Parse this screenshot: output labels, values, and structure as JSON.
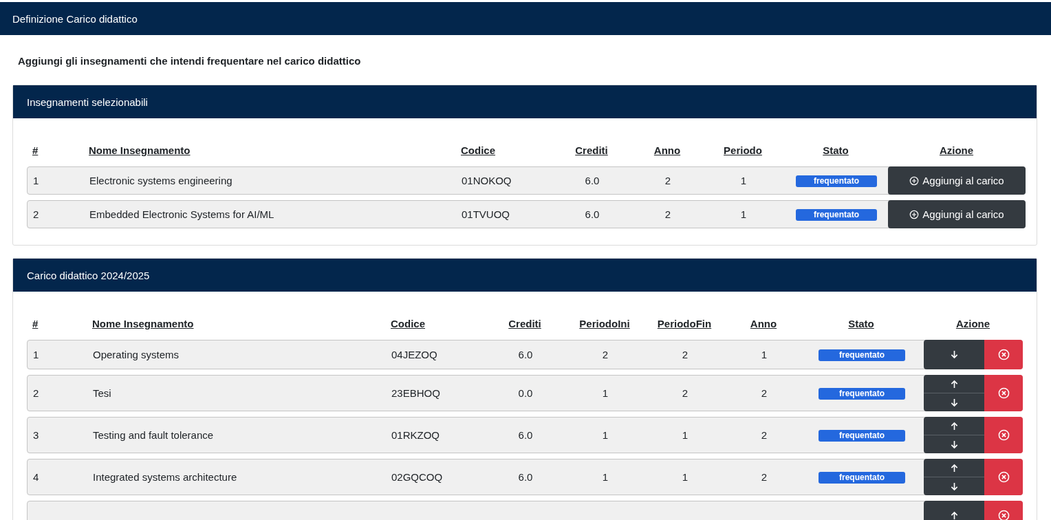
{
  "topbar": {
    "title": "Definizione Carico didattico"
  },
  "intro": "Aggiungi gli insegnamenti che intendi frequentare nel carico didattico",
  "selectable": {
    "title": "Insegnamenti selezionabili",
    "columns": [
      "#",
      "Nome Insegnamento",
      "Codice",
      "Crediti",
      "Anno",
      "Periodo",
      "Stato",
      "Azione"
    ],
    "rows": [
      {
        "n": "1",
        "name": "Electronic systems engineering",
        "code": "01NOKOQ",
        "credits": "6.0",
        "year": "2",
        "period": "1",
        "status": "frequentato",
        "action": "Aggiungi al carico"
      },
      {
        "n": "2",
        "name": "Embedded Electronic Systems for AI/ML",
        "code": "01TVUOQ",
        "credits": "6.0",
        "year": "2",
        "period": "1",
        "status": "frequentato",
        "action": "Aggiungi al carico"
      }
    ]
  },
  "load": {
    "title": "Carico didattico 2024/2025",
    "columns": [
      "#",
      "Nome Insegnamento",
      "Codice",
      "Crediti",
      "PeriodoIni",
      "PeriodoFin",
      "Anno",
      "Stato",
      "Azione"
    ],
    "rows": [
      {
        "kind": "full",
        "n": "1",
        "name": "Operating systems",
        "code": "04JEZOQ",
        "credits": "6.0",
        "period_start": "2",
        "period_end": "2",
        "year": "1",
        "status": "frequentato",
        "can_move_up": false,
        "can_move_down": true
      },
      {
        "kind": "full",
        "n": "2",
        "name": "Tesi",
        "code": "23EBHOQ",
        "credits": "0.0",
        "period_start": "1",
        "period_end": "2",
        "year": "2",
        "status": "frequentato",
        "can_move_up": true,
        "can_move_down": true
      },
      {
        "kind": "full",
        "n": "3",
        "name": "Testing and fault tolerance",
        "code": "01RKZOQ",
        "credits": "6.0",
        "period_start": "1",
        "period_end": "1",
        "year": "2",
        "status": "frequentato",
        "can_move_up": true,
        "can_move_down": true
      },
      {
        "kind": "full",
        "n": "4",
        "name": "Integrated systems architecture",
        "code": "02GQCOQ",
        "credits": "6.0",
        "period_start": "1",
        "period_end": "1",
        "year": "2",
        "status": "frequentato",
        "can_move_up": true,
        "can_move_down": true
      },
      {
        "kind": "cut",
        "can_move_up": true
      }
    ]
  }
}
